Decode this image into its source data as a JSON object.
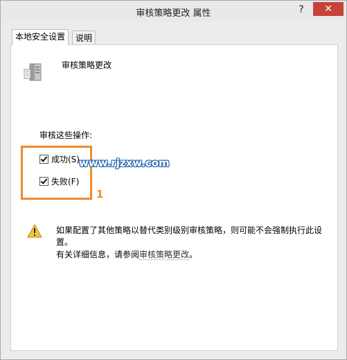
{
  "window": {
    "title": "审核策略更改 属性",
    "help_symbol": "?",
    "close_symbol": "✕",
    "close_color": "#c7423a"
  },
  "tabs": [
    {
      "label": "本地安全设置",
      "active": true
    },
    {
      "label": "说明",
      "active": false
    }
  ],
  "policy": {
    "name": "审核策略更改",
    "icon": "server-icon"
  },
  "audit": {
    "label": "审核这些操作:",
    "options": [
      {
        "label": "成功(S)",
        "checked": true
      },
      {
        "label": "失败(F)",
        "checked": true
      }
    ]
  },
  "annotation": {
    "number": "1",
    "color": "#ef8b2c"
  },
  "watermark": "www.rjzxw.com",
  "warning": {
    "icon": "warning-icon",
    "text": "如果配置了其他策略以替代类别级别审核策略，则可能不会强制执行此设置。",
    "more_info_prefix": "有关详细信息，请参阅",
    "more_info_link": "审核策略更改",
    "more_info_suffix": "。"
  }
}
